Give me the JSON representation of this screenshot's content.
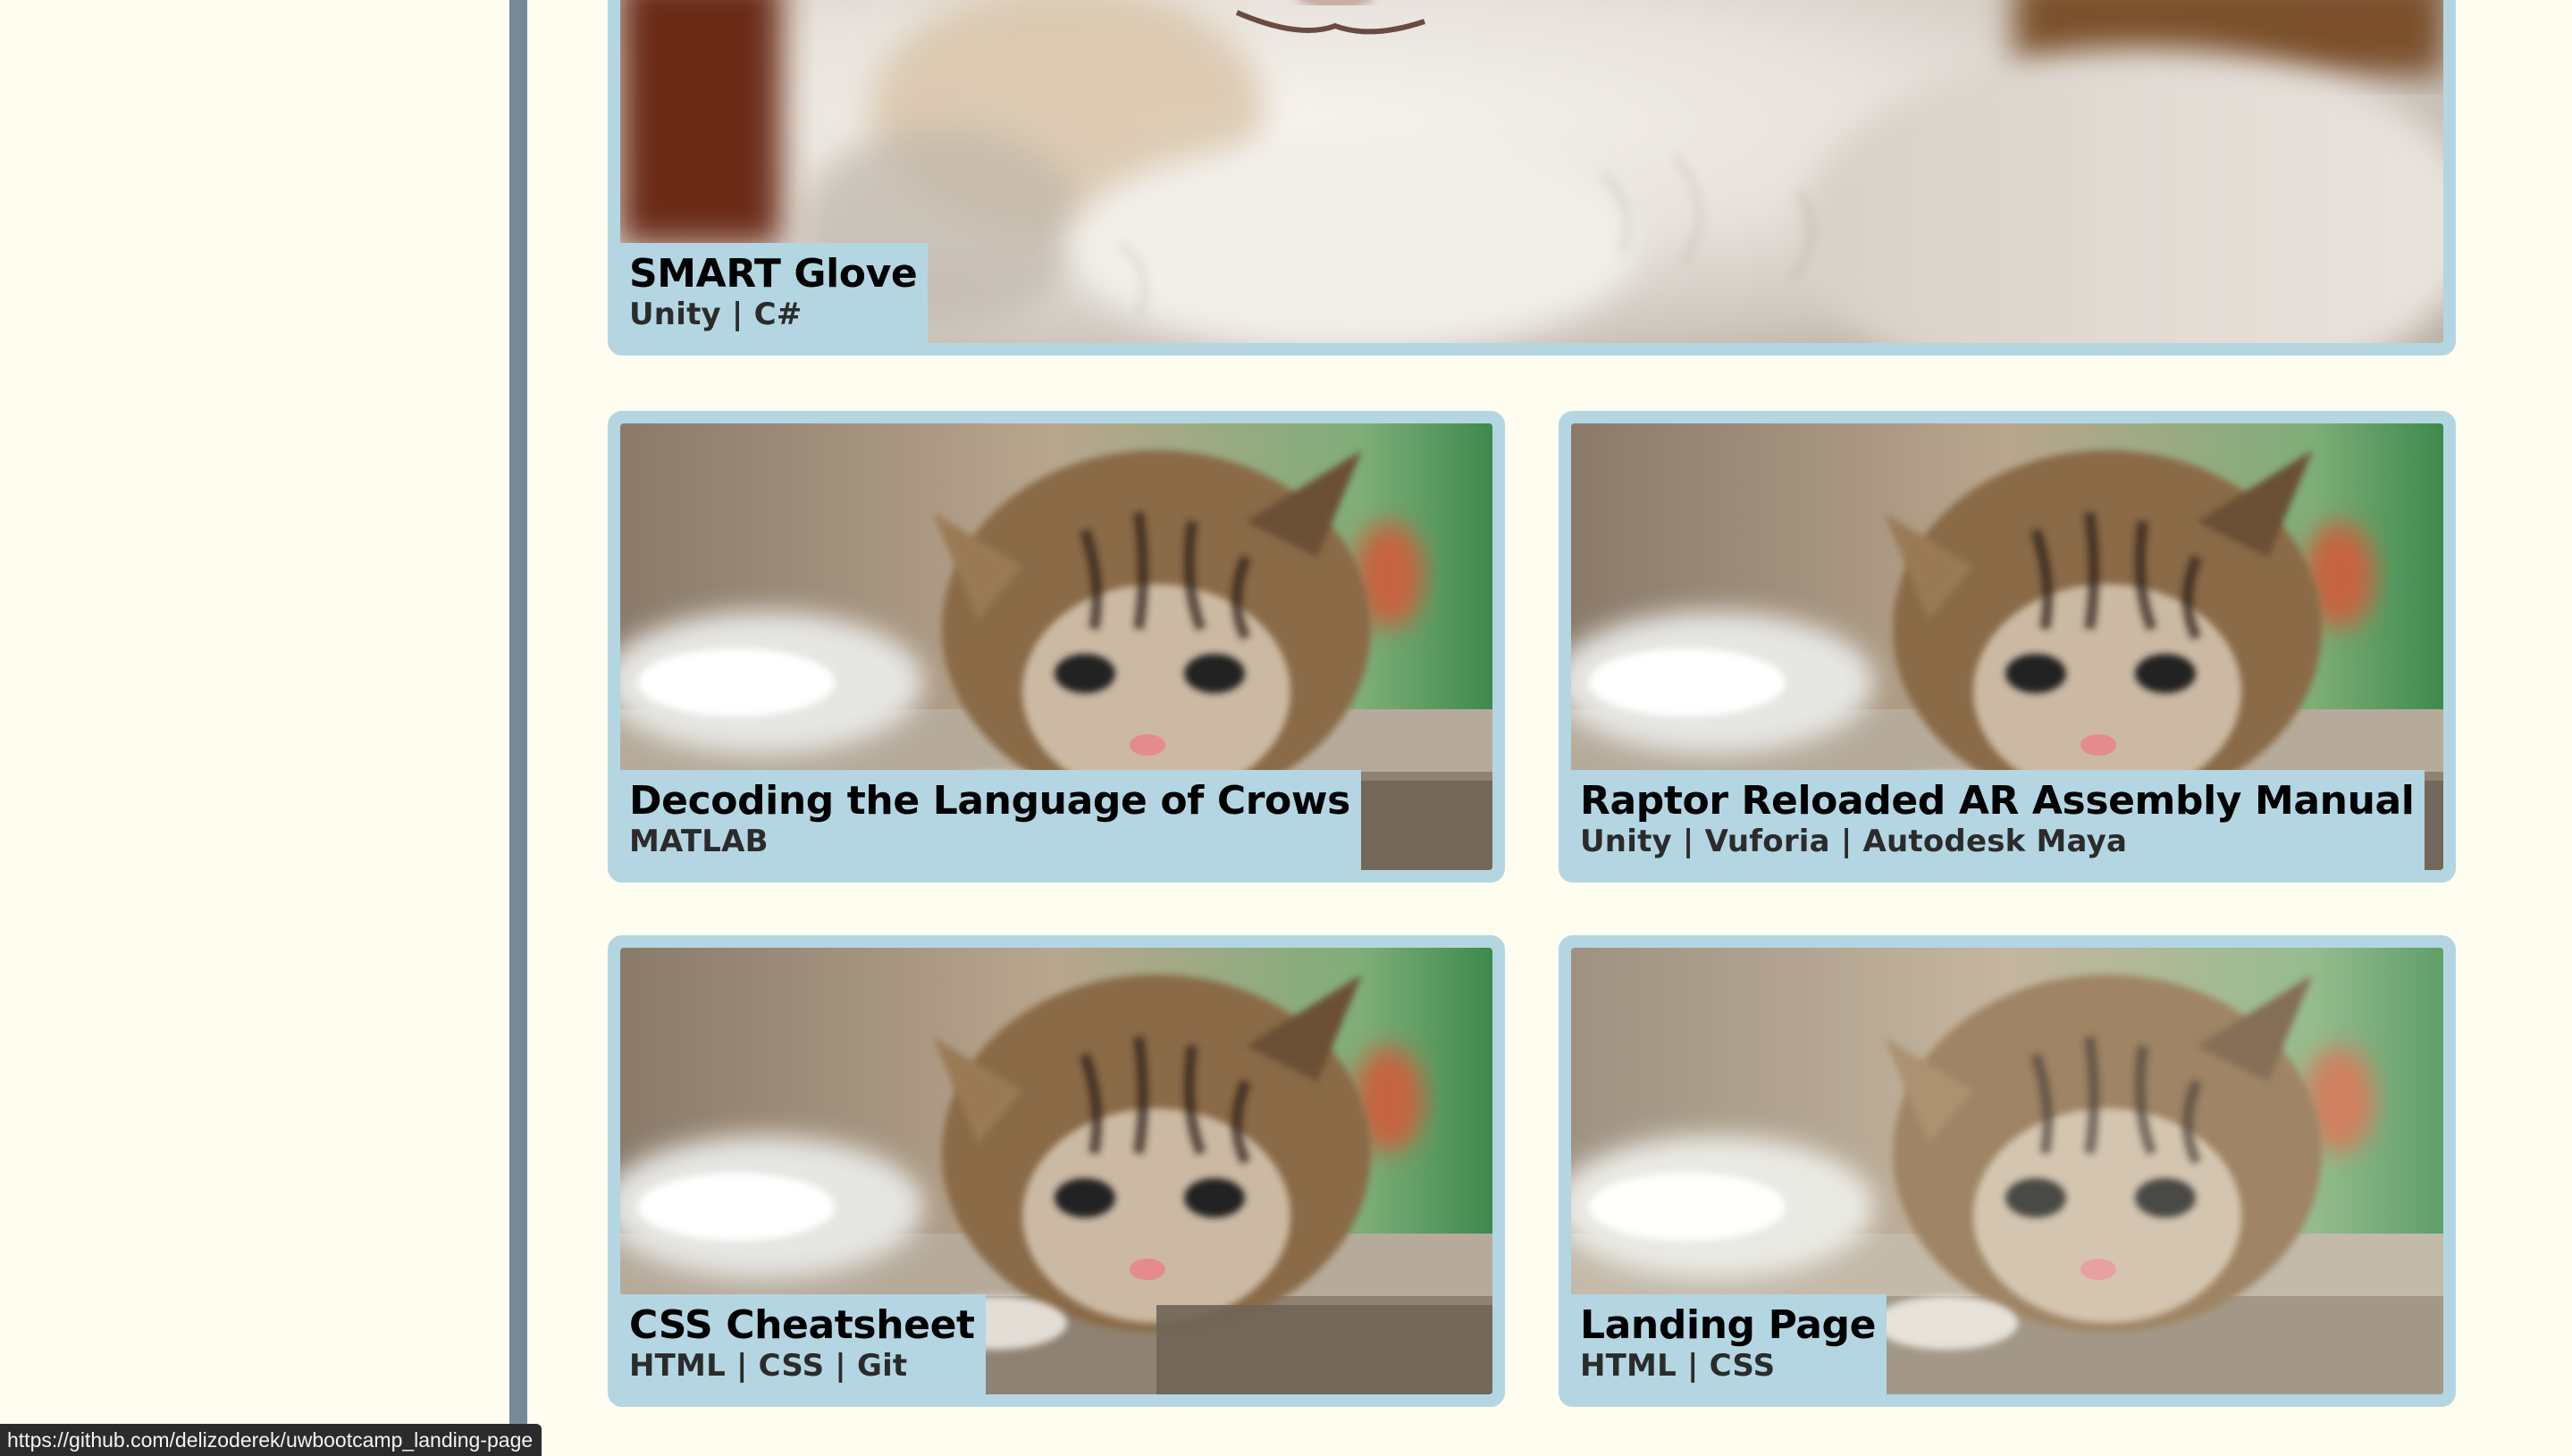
{
  "projects": [
    {
      "title": "SMART Glove",
      "tech": "Unity | C#",
      "photo": "white-kitten-photo"
    },
    {
      "title": "Decoding the Language of Crows",
      "tech": "MATLAB",
      "photo": "tabby-kitten-photo"
    },
    {
      "title": "Raptor Reloaded AR Assembly Manual",
      "tech": "Unity | Vuforia | Autodesk Maya",
      "photo": "tabby-kitten-photo"
    },
    {
      "title": "CSS Cheatsheet",
      "tech": "HTML | CSS | Git",
      "photo": "tabby-kitten-photo"
    },
    {
      "title": "Landing Page",
      "tech": "HTML | CSS",
      "photo": "tabby-kitten-photo"
    }
  ],
  "status_bar": {
    "url": "https://github.com/delizoderek/uwbootcamp_landing-page"
  },
  "colors": {
    "page_background": "#fffdf0",
    "sidebar_border": "#778899",
    "card_frame": "#b4d6e2",
    "caption_text": "#000000"
  }
}
